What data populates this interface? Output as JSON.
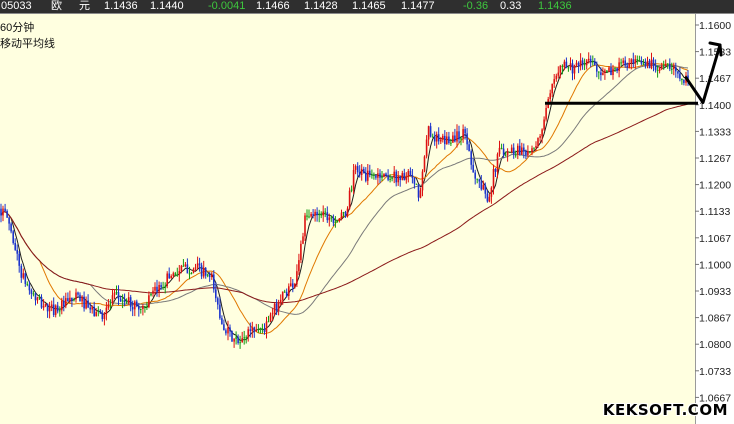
{
  "header": {
    "code": "05033",
    "name1": "欧",
    "name2": "元",
    "v1": "1.1436",
    "v2": "1.1440",
    "change": "-0.0041",
    "v3": "1.1466",
    "v4": "1.1428",
    "v5": "1.1465",
    "v6": "1.1477",
    "v7": "-0.36",
    "v8": "0.33",
    "v9": "1.1436"
  },
  "labels": {
    "period": "60分钟",
    "ma": "移动平均线"
  },
  "watermark": "KEKSOFT.COM",
  "chart_data": {
    "type": "candlestick",
    "y_ticks": [
      "1.1600",
      "1.1533",
      "1.1467",
      "1.1400",
      "1.1333",
      "1.1267",
      "1.1200",
      "1.1133",
      "1.1067",
      "1.1000",
      "1.0933",
      "1.0867",
      "1.0800",
      "1.0733",
      "1.0667"
    ],
    "ylim": [
      1.064,
      1.163
    ],
    "n_bars": 340,
    "price_path": [
      [
        0,
        1.114
      ],
      [
        8,
        1.1115
      ],
      [
        22,
        1.097
      ],
      [
        35,
        1.0915
      ],
      [
        50,
        1.0885
      ],
      [
        65,
        1.09
      ],
      [
        78,
        1.092
      ],
      [
        90,
        1.0885
      ],
      [
        102,
        1.0875
      ],
      [
        115,
        1.092
      ],
      [
        128,
        1.0905
      ],
      [
        142,
        1.089
      ],
      [
        155,
        1.093
      ],
      [
        170,
        1.0975
      ],
      [
        185,
        1.099
      ],
      [
        198,
        1.099
      ],
      [
        212,
        1.096
      ],
      [
        220,
        1.087
      ],
      [
        230,
        1.082
      ],
      [
        240,
        1.08
      ],
      [
        250,
        1.084
      ],
      [
        265,
        1.084
      ],
      [
        280,
        1.0915
      ],
      [
        295,
        1.096
      ],
      [
        305,
        1.111
      ],
      [
        320,
        1.1135
      ],
      [
        335,
        1.1115
      ],
      [
        345,
        1.112
      ],
      [
        355,
        1.124
      ],
      [
        368,
        1.122
      ],
      [
        380,
        1.1225
      ],
      [
        395,
        1.122
      ],
      [
        410,
        1.122
      ],
      [
        420,
        1.117
      ],
      [
        428,
        1.134
      ],
      [
        440,
        1.1305
      ],
      [
        455,
        1.132
      ],
      [
        465,
        1.133
      ],
      [
        475,
        1.122
      ],
      [
        488,
        1.117
      ],
      [
        500,
        1.129
      ],
      [
        510,
        1.1285
      ],
      [
        522,
        1.129
      ],
      [
        535,
        1.128
      ],
      [
        548,
        1.14
      ],
      [
        560,
        1.151
      ],
      [
        575,
        1.149
      ],
      [
        590,
        1.151
      ],
      [
        605,
        1.1475
      ],
      [
        620,
        1.15
      ],
      [
        635,
        1.15
      ],
      [
        650,
        1.1505
      ],
      [
        665,
        1.1495
      ],
      [
        680,
        1.148
      ],
      [
        690,
        1.145
      ]
    ],
    "moving_averages": [
      {
        "color": "#1e1e1e",
        "period": 5
      },
      {
        "color": "#e07800",
        "period": 20
      },
      {
        "color": "#7a7a7a",
        "period": 45
      },
      {
        "color": "#8b1a1a",
        "period": 120
      }
    ],
    "annotations": [
      {
        "type": "horizontal_line",
        "y": 1.1404,
        "x_start": 545,
        "x_end": 698,
        "color": "#000000"
      },
      {
        "type": "arrow",
        "color": "#000000",
        "points": [
          [
            686,
            1.1468
          ],
          [
            703,
            1.1406
          ],
          [
            720,
            1.155
          ]
        ]
      }
    ],
    "colors": {
      "up": "#dd1111",
      "down": "#1a33cc",
      "doji": "#119911",
      "background": "#ffffe0",
      "axis_bg": "#ffffff"
    }
  }
}
